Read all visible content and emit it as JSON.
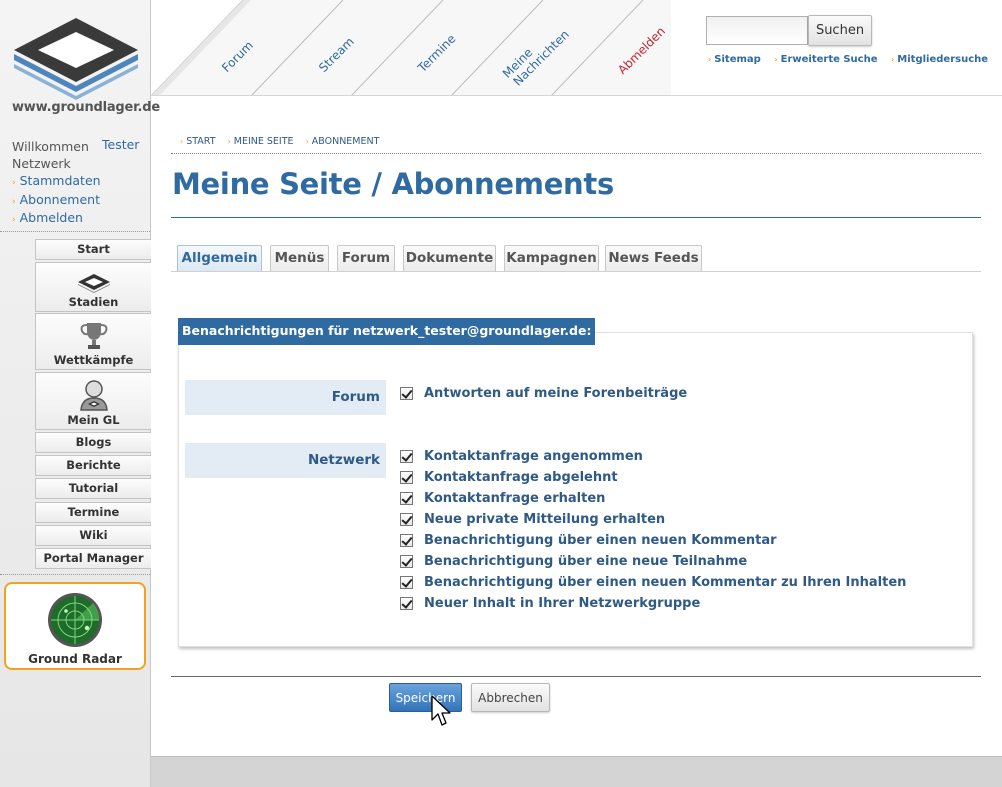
{
  "sidebar": {
    "logo_text": "www.groundlager.de",
    "welcome": "Willkommen",
    "user": "Tester",
    "network_label": "Netzwerk",
    "links": [
      "Stammdaten",
      "Abonnement",
      "Abmelden"
    ],
    "nav": {
      "start": "Start",
      "stadien": "Stadien",
      "wettkaempfe": "Wettkämpfe",
      "mein_gl": "Mein GL",
      "blogs": "Blogs",
      "berichte": "Berichte",
      "tutorial": "Tutorial",
      "termine": "Termine",
      "wiki": "Wiki",
      "portal_manager": "Portal Manager"
    },
    "radar_label": "Ground Radar"
  },
  "header": {
    "tabs": {
      "forum": "Forum",
      "stream": "Stream",
      "termine": "Termine",
      "nachrichten_1": "Meine",
      "nachrichten_2": "Nachrichten",
      "abmelden": "Abmelden"
    },
    "search": {
      "value": "",
      "button": "Suchen"
    },
    "links": [
      "Sitemap",
      "Erweiterte Suche",
      "Mitgliedersuche"
    ]
  },
  "main": {
    "breadcrumb": [
      "START",
      "MEINE SEITE",
      "ABONNEMENT"
    ],
    "title": "Meine Seite / Abonnements",
    "tabs": [
      "Allgemein",
      "Menüs",
      "Forum",
      "Dokumente",
      "Kampagnen",
      "News Feeds"
    ],
    "active_tab": "Allgemein",
    "panel_heading": "Benachrichtigungen für netzwerk_tester@groundlager.de:",
    "groups": {
      "forum": {
        "label": "Forum",
        "options": [
          {
            "label": "Antworten auf meine Forenbeiträge",
            "checked": true
          }
        ]
      },
      "netzwerk": {
        "label": "Netzwerk",
        "options": [
          {
            "label": "Kontaktanfrage angenommen",
            "checked": true
          },
          {
            "label": "Kontaktanfrage abgelehnt",
            "checked": true
          },
          {
            "label": "Kontaktanfrage erhalten",
            "checked": true
          },
          {
            "label": "Neue private Mitteilung erhalten",
            "checked": true
          },
          {
            "label": "Benachrichtigung über einen neuen Kommentar",
            "checked": true
          },
          {
            "label": "Benachrichtigung über eine neue Teilnahme",
            "checked": true
          },
          {
            "label": "Benachrichtigung über einen neuen Kommentar zu Ihren Inhalten",
            "checked": true
          },
          {
            "label": "Neuer Inhalt in Ihrer Netzwerkgruppe",
            "checked": true
          }
        ]
      }
    },
    "buttons": {
      "save": "Speichern",
      "cancel": "Abbrechen"
    }
  },
  "colors": {
    "accent": "#2f6aa0",
    "highlight": "#f2a31d",
    "logout": "#c0272d"
  }
}
